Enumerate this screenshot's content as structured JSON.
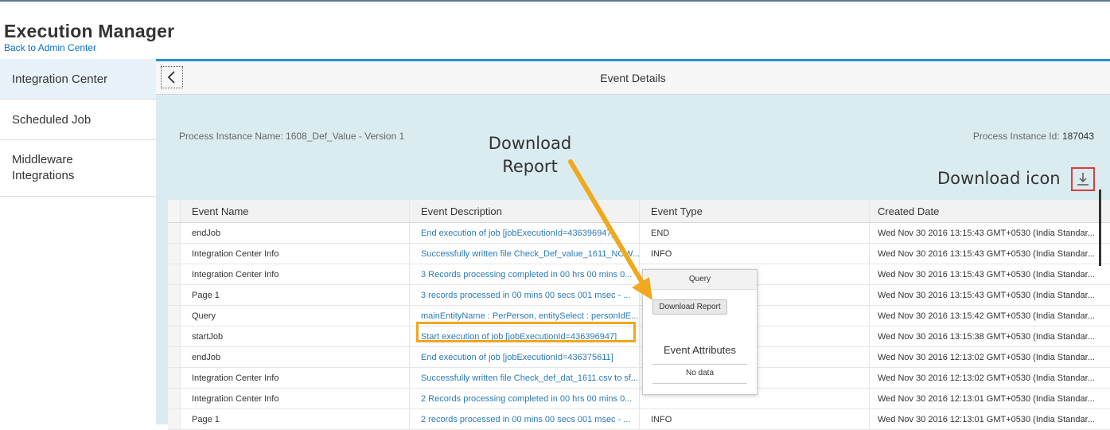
{
  "app": {
    "title": "Execution Manager",
    "back_link": "Back to Admin Center"
  },
  "sidebar": {
    "items": [
      {
        "label": "Integration Center",
        "active": true
      },
      {
        "label": "Scheduled Job",
        "active": false
      },
      {
        "label": "Middleware Integrations",
        "active": false
      }
    ]
  },
  "header": {
    "back_icon": "chevron-left-icon",
    "title": "Event Details"
  },
  "process": {
    "name_label": "Process Instance Name: 1608_Def_Value - Version 1",
    "id_label": "Process Instance Id:",
    "id_value": "187043"
  },
  "download_icon": "download-icon",
  "table": {
    "columns": [
      "Event Name",
      "Event Description",
      "Event Type",
      "Created Date"
    ],
    "rows": [
      {
        "name": "endJob",
        "description": "End execution of job [jobExecutionId=436396947]",
        "type": "END",
        "date": "Wed Nov 30 2016 13:15:43 GMT+0530 (India Standar..."
      },
      {
        "name": "Integration Center Info",
        "description": "Successfully written file Check_Def_value_1611_NOW...",
        "type": "INFO",
        "date": "Wed Nov 30 2016 13:15:43 GMT+0530 (India Standar..."
      },
      {
        "name": "Integration Center Info",
        "description": "3 Records processing completed in 00 hrs 00 mins 0...",
        "type": "INFO",
        "date": "Wed Nov 30 2016 13:15:43 GMT+0530 (India Standar..."
      },
      {
        "name": "Page 1",
        "description": "3 records processed in 00 mins 00 secs 001 msec - ...",
        "type": "",
        "date": "Wed Nov 30 2016 13:15:43 GMT+0530 (India Standar..."
      },
      {
        "name": "Query",
        "description": "mainEntityName : PerPerson, entitySelect : personIdE...",
        "type": "",
        "date": "Wed Nov 30 2016 13:15:42 GMT+0530 (India Standar..."
      },
      {
        "name": "startJob",
        "description": "Start execution of job [jobExecutionId=436396947]",
        "type": "",
        "date": "Wed Nov 30 2016 13:15:38 GMT+0530 (India Standar..."
      },
      {
        "name": "endJob",
        "description": "End execution of job [jobExecutionId=436375611]",
        "type": "",
        "date": "Wed Nov 30 2016 12:13:02 GMT+0530 (India Standar..."
      },
      {
        "name": "Integration Center Info",
        "description": "Successfully written file Check_def_dat_1611.csv to sf...",
        "type": "",
        "date": "Wed Nov 30 2016 12:13:02 GMT+0530 (India Standar..."
      },
      {
        "name": "Integration Center Info",
        "description": "2 Records processing completed in 00 hrs 00 mins 0...",
        "type": "",
        "date": "Wed Nov 30 2016 12:13:01 GMT+0530 (India Standar..."
      },
      {
        "name": "Page 1",
        "description": "2 records processed in 00 mins 00 secs 001 msec - ...",
        "type": "INFO",
        "date": "Wed Nov 30 2016 12:13:01 GMT+0530 (India Standar..."
      }
    ]
  },
  "popover": {
    "title": "Query",
    "button": "Download Report",
    "section_title": "Event Attributes",
    "empty_text": "No data"
  },
  "annotations": {
    "download_report": "Download Report",
    "download_icon": "Download icon",
    "arrow_color": "#f0a81e",
    "highlight_color": "#f0a81e",
    "icon_box_color": "#e03c3c"
  }
}
